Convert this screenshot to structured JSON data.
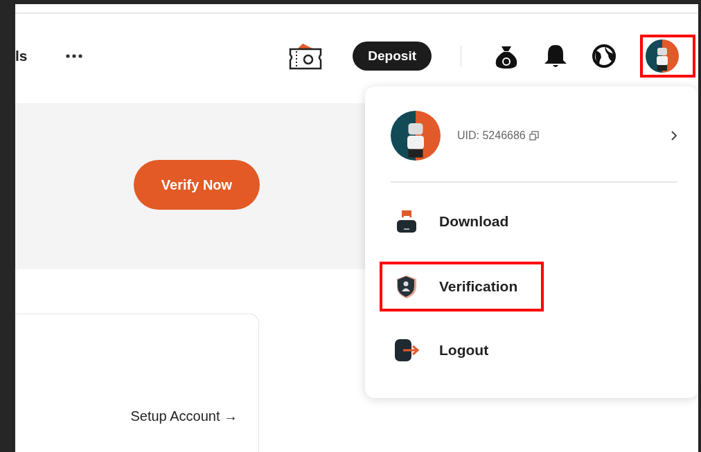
{
  "header": {
    "nav_partial": "ls",
    "deposit_button": "Deposit",
    "avatar": {
      "highlighted": true
    }
  },
  "banner": {
    "button": "Verify Now"
  },
  "card": {
    "link": "Setup Account →"
  },
  "user_menu": {
    "uid": "UID: 5246686",
    "items": [
      {
        "kind": "download",
        "label": "Download",
        "highlighted": false
      },
      {
        "kind": "verification",
        "label": "Verification",
        "highlighted": true
      },
      {
        "kind": "logout",
        "label": "Logout",
        "highlighted": false
      }
    ]
  }
}
